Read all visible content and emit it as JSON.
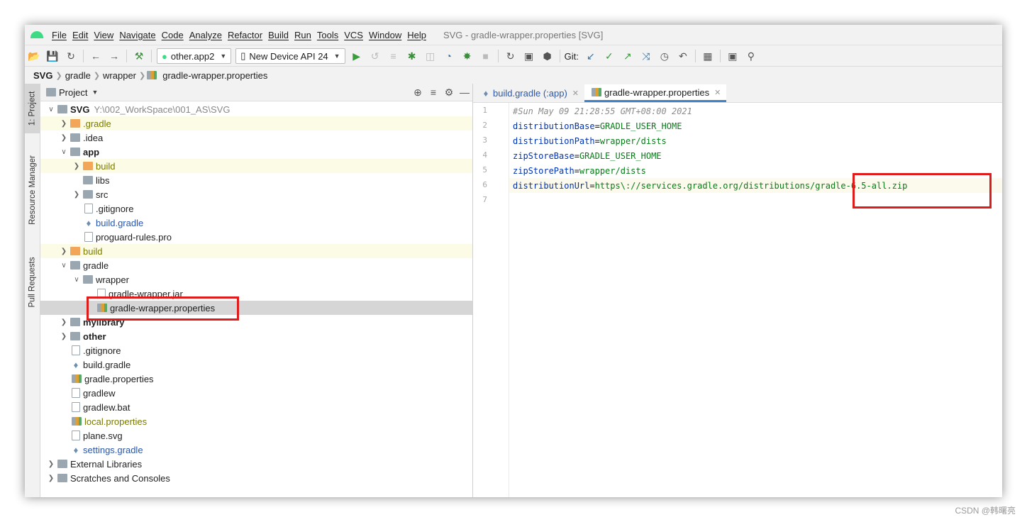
{
  "menu": [
    "File",
    "Edit",
    "View",
    "Navigate",
    "Code",
    "Analyze",
    "Refactor",
    "Build",
    "Run",
    "Tools",
    "VCS",
    "Window",
    "Help"
  ],
  "window_title": "SVG - gradle-wrapper.properties [SVG]",
  "toolbar": {
    "run_config": "other.app2",
    "device": "New Device API 24",
    "git_label": "Git:"
  },
  "breadcrumb": [
    "SVG",
    "gradle",
    "wrapper",
    "gradle-wrapper.properties"
  ],
  "left_stripe": [
    "1: Project",
    "Resource Manager",
    "Pull Requests"
  ],
  "project_panel": {
    "title": "Project",
    "tree": [
      {
        "label": "SVG",
        "path": "Y:\\002_WorkSpace\\001_AS\\SVG"
      },
      {
        "label": ".gradle"
      },
      {
        "label": ".idea"
      },
      {
        "label": "app"
      },
      {
        "label": "build"
      },
      {
        "label": "libs"
      },
      {
        "label": "src"
      },
      {
        "label": ".gitignore"
      },
      {
        "label": "build.gradle"
      },
      {
        "label": "proguard-rules.pro"
      },
      {
        "label": "build"
      },
      {
        "label": "gradle"
      },
      {
        "label": "wrapper"
      },
      {
        "label": "gradle-wrapper.jar"
      },
      {
        "label": "gradle-wrapper.properties"
      },
      {
        "label": "mylibrary"
      },
      {
        "label": "other"
      },
      {
        "label": ".gitignore"
      },
      {
        "label": "build.gradle"
      },
      {
        "label": "gradle.properties"
      },
      {
        "label": "gradlew"
      },
      {
        "label": "gradlew.bat"
      },
      {
        "label": "local.properties"
      },
      {
        "label": "plane.svg"
      },
      {
        "label": "settings.gradle"
      },
      {
        "label": "External Libraries"
      },
      {
        "label": "Scratches and Consoles"
      }
    ]
  },
  "editor": {
    "tabs": [
      "build.gradle (:app)",
      "gradle-wrapper.properties"
    ],
    "lines": [
      {
        "num": "1",
        "comment": "#Sun May 09 21:28:55 GMT+08:00 2021"
      },
      {
        "num": "2",
        "key": "distributionBase",
        "eq": "=",
        "val": "GRADLE_USER_HOME"
      },
      {
        "num": "3",
        "key": "distributionPath",
        "eq": "=",
        "val": "wrapper/dists"
      },
      {
        "num": "4",
        "key": "zipStoreBase",
        "eq": "=",
        "val": "GRADLE_USER_HOME"
      },
      {
        "num": "5",
        "key": "zipStorePath",
        "eq": "=",
        "val": "wrapper/dists"
      },
      {
        "num": "6",
        "key": "distributionUrl",
        "eq": "=",
        "val": "https\\://services.gradle.org/distributions/gradle-6.5-all.zip"
      },
      {
        "num": "7"
      }
    ]
  },
  "watermark": "CSDN @韩曙亮",
  "colors": {
    "highlight_box": "#e01b1b",
    "accent": "#4083c9"
  }
}
